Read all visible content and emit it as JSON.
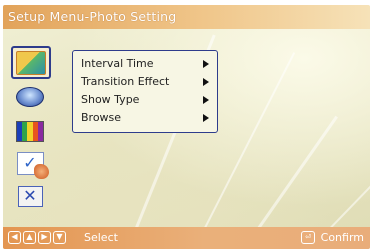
{
  "window": {
    "title": "Setup Menu-Photo Setting"
  },
  "side_menu": {
    "icons": [
      {
        "name": "photo-settings-icon",
        "selected": true
      },
      {
        "name": "speedometer-icon",
        "selected": false
      },
      {
        "name": "color-bars-icon",
        "selected": false
      },
      {
        "name": "checklist-icon",
        "selected": false
      },
      {
        "name": "close-icon",
        "selected": false
      }
    ]
  },
  "submenu": {
    "items": [
      {
        "label": "Interval Time",
        "highlighted": true
      },
      {
        "label": "Transition Effect",
        "highlighted": false
      },
      {
        "label": "Show Type",
        "highlighted": false
      },
      {
        "label": "Browse",
        "highlighted": false
      }
    ]
  },
  "footer": {
    "nav_keys": [
      "left-arrow-icon",
      "up-arrow-icon",
      "right-arrow-icon",
      "down-arrow-icon"
    ],
    "select_label": "Select",
    "confirm_key": "enter-key-icon",
    "confirm_label": "Confirm"
  },
  "colors": {
    "title_bar": "#e2a35a",
    "footer_bar": "#e39550",
    "selection_border": "#2e3c8c",
    "background": "#ecebcf"
  }
}
